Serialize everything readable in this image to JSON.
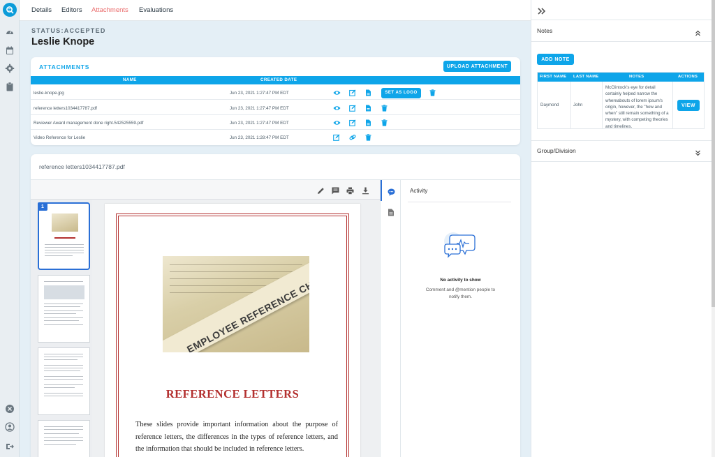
{
  "rail": {
    "icons": [
      "app-logo-icon",
      "dashboard-icon",
      "calendar-icon",
      "settings-icon",
      "clipboard-icon",
      "close-circle-icon",
      "user-icon",
      "logout-icon"
    ]
  },
  "tabs": [
    {
      "label": "Details"
    },
    {
      "label": "Editors"
    },
    {
      "label": "Attachments"
    },
    {
      "label": "Evaluations"
    }
  ],
  "active_tab": "Attachments",
  "status": "STATUS:ACCEPTED",
  "person_name": "Leslie Knope",
  "attachments": {
    "title": "ATTACHMENTS",
    "upload_label": "UPLOAD ATTACHMENT",
    "columns": [
      "NAME",
      "CREATED DATE"
    ],
    "set_logo_label": "SET AS LOGO",
    "rows": [
      {
        "name": "leslie-knope.jpg",
        "date": "Jun 23, 2021 1:27:47 PM EDT",
        "actions": [
          "view-icon",
          "edit-icon",
          "file-icon",
          "set-as-logo",
          "delete-icon"
        ]
      },
      {
        "name": "reference letters1034417787.pdf",
        "date": "Jun 23, 2021 1:27:47 PM EDT",
        "actions": [
          "view-icon",
          "edit-icon",
          "file-icon",
          "delete-icon"
        ]
      },
      {
        "name": "Reviewer Award management done right.542525559.pdf",
        "date": "Jun 23, 2021 1:27:47 PM EDT",
        "actions": [
          "view-icon",
          "edit-icon",
          "file-icon",
          "delete-icon"
        ]
      },
      {
        "name": "Video Reference for Leslie",
        "date": "Jun 23, 2021 1:28:47 PM EDT",
        "actions": [
          "edit-icon",
          "link-icon",
          "delete-icon"
        ]
      }
    ]
  },
  "viewer": {
    "file_name": "reference letters1034417787.pdf",
    "page_badge": "1",
    "toolbar_icons": [
      "annotate-pen-icon",
      "comment-box-icon",
      "print-icon",
      "download-icon"
    ],
    "page": {
      "photo_caption": "EMPLOYEE REFERENCE CHECK",
      "heading": "REFERENCE LETTERS",
      "body": "These slides provide important information about the purpose of reference letters, the differences in the types of reference letters, and the information that should be included in reference letters."
    }
  },
  "activity": {
    "title": "Activity",
    "empty_title": "No activity to show",
    "empty_sub": "Comment and @mention people to notify them."
  },
  "notes_panel": {
    "title": "Notes",
    "add_label": "ADD NOTE",
    "columns": [
      "FIRST NAME",
      "LAST NAME",
      "NOTES",
      "ACTIONS"
    ],
    "row": {
      "first_name": "Daymond",
      "last_name": "John",
      "note": "McClintock's eye for detail certainly helped narrow the whereabouts of lorem ipsum's origin, however, the \"how and when\" still remain something of a mystery, with competing theories and timelines.",
      "action": "VIEW"
    },
    "group_title": "Group/Division"
  },
  "colors": {
    "accent": "#0ea5e9",
    "active_tab": "#ea6c6c",
    "pdf_red": "#b3302f"
  }
}
